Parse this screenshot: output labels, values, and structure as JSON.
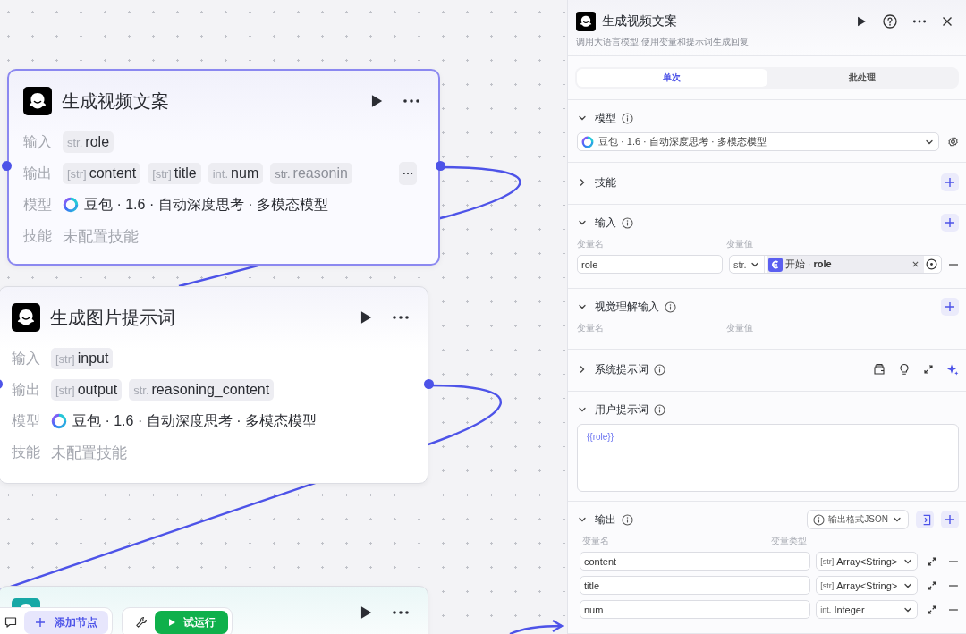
{
  "canvas": {
    "nodes": [
      {
        "title": "生成视频文案",
        "selected": true,
        "color": "#000000",
        "rows": [
          {
            "kind": "tags",
            "label": "输入",
            "more": false,
            "tags": [
              {
                "type": "str.",
                "name": "role",
                "faded": false
              }
            ]
          },
          {
            "kind": "tags",
            "label": "输出",
            "more": true,
            "tags": [
              {
                "type": "[str]",
                "name": "content",
                "faded": false
              },
              {
                "type": "[str]",
                "name": "title",
                "faded": false
              },
              {
                "type": "int.",
                "name": "num",
                "faded": false
              },
              {
                "type": "str.",
                "name": "reasonin",
                "faded": true
              }
            ]
          },
          {
            "kind": "model",
            "label": "模型",
            "value": "豆包 · 1.6 · 自动深度思考 · 多模态模型"
          },
          {
            "kind": "empty",
            "label": "技能",
            "value": "未配置技能"
          }
        ]
      },
      {
        "title": "生成图片提示词",
        "selected": false,
        "color": "#000000",
        "rows": [
          {
            "kind": "tags",
            "label": "输入",
            "more": false,
            "tags": [
              {
                "type": "[str]",
                "name": "input",
                "faded": false
              }
            ]
          },
          {
            "kind": "tags",
            "label": "输出",
            "more": false,
            "tags": [
              {
                "type": "[str]",
                "name": "output",
                "faded": false
              },
              {
                "type": "str.",
                "name": "reasoning_content",
                "faded": false
              }
            ]
          },
          {
            "kind": "model",
            "label": "模型",
            "value": "豆包 · 1.6 · 自动深度思考 · 多模态模型"
          },
          {
            "kind": "empty",
            "label": "技能",
            "value": "未配置技能"
          }
        ]
      },
      {
        "selected": false,
        "color": "#17a8a6"
      }
    ],
    "toolbar": {
      "add_node": "添加节点",
      "test_run": "试运行"
    }
  },
  "panel": {
    "title": "生成视频文案",
    "subtitle": "调用大语言模型,使用变量和提示词生成回复",
    "tabs": [
      {
        "label": "单次",
        "selected": true
      },
      {
        "label": "批处理",
        "selected": false
      }
    ],
    "sections": [
      {
        "kind": "model",
        "title": "模型",
        "expanded": true,
        "info": true,
        "model": "豆包 · 1.6 · 自动深度思考 · 多模态模型"
      },
      {
        "kind": "skills",
        "title": "技能",
        "expanded": false,
        "info": false
      },
      {
        "kind": "inputs",
        "title": "输入",
        "expanded": true,
        "info": true,
        "columns": [
          "变量名",
          "变量值"
        ],
        "rows": [
          {
            "name": "role",
            "type": "str.",
            "ref": "开始 · **role**"
          }
        ]
      },
      {
        "kind": "vision",
        "title": "视觉理解输入",
        "expanded": true,
        "info": true,
        "columns": [
          "变量名",
          "变量值"
        ]
      },
      {
        "kind": "system_prompt",
        "title": "系统提示词",
        "expanded": false,
        "info": true
      },
      {
        "kind": "user_prompt",
        "title": "用户提示词",
        "expanded": true,
        "info": true,
        "value": "{{role}}"
      },
      {
        "kind": "outputs",
        "title": "输出",
        "expanded": true,
        "info": true,
        "format": "输出格式JSON",
        "columns": [
          "变量名",
          "变量类型"
        ],
        "rows": [
          {
            "name": "content",
            "type_tag": "[str]",
            "type": "Array<String>"
          },
          {
            "name": "title",
            "type_tag": "[str]",
            "type": "Array<String>"
          },
          {
            "name": "num",
            "type_tag": "int.",
            "type": "Integer"
          }
        ]
      }
    ]
  }
}
